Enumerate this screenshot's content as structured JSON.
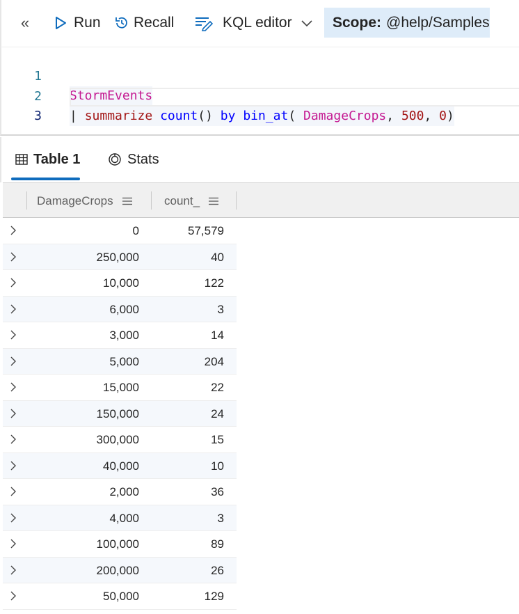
{
  "toolbar": {
    "collapse_glyph": "«",
    "run_label": "Run",
    "recall_label": "Recall",
    "editor_mode_label": "KQL editor",
    "scope_label": "Scope:",
    "scope_value": "@help/Samples"
  },
  "editor": {
    "line_numbers": [
      "1",
      "2",
      "3"
    ],
    "line1": {
      "table": "StormEvents"
    },
    "line2": {
      "pipe": "| ",
      "op": "summarize",
      "sp1": " ",
      "fn1": "count",
      "paren1": "()",
      "sp2": " ",
      "by": "by",
      "sp3": " ",
      "fn2": "bin_at",
      "open": "( ",
      "col": "DamageCrops",
      "comma1": ", ",
      "num1": "500",
      "comma2": ", ",
      "num2": "0",
      "close": ")"
    }
  },
  "results": {
    "tabs": [
      {
        "label": "Table 1",
        "icon": "table-icon"
      },
      {
        "label": "Stats",
        "icon": "stats-icon"
      }
    ],
    "columns": [
      "DamageCrops",
      "count_"
    ],
    "rows": [
      [
        "0",
        "57,579"
      ],
      [
        "250,000",
        "40"
      ],
      [
        "10,000",
        "122"
      ],
      [
        "6,000",
        "3"
      ],
      [
        "3,000",
        "14"
      ],
      [
        "5,000",
        "204"
      ],
      [
        "15,000",
        "22"
      ],
      [
        "150,000",
        "24"
      ],
      [
        "300,000",
        "15"
      ],
      [
        "40,000",
        "10"
      ],
      [
        "2,000",
        "36"
      ],
      [
        "4,000",
        "3"
      ],
      [
        "100,000",
        "89"
      ],
      [
        "200,000",
        "26"
      ],
      [
        "50,000",
        "129"
      ]
    ]
  },
  "colors": {
    "accent": "#0f6cbd",
    "scope_bg": "#deecf9",
    "keyword_pink": "#c41891",
    "keyword_red": "#a31515",
    "function_blue": "#0000ff"
  }
}
